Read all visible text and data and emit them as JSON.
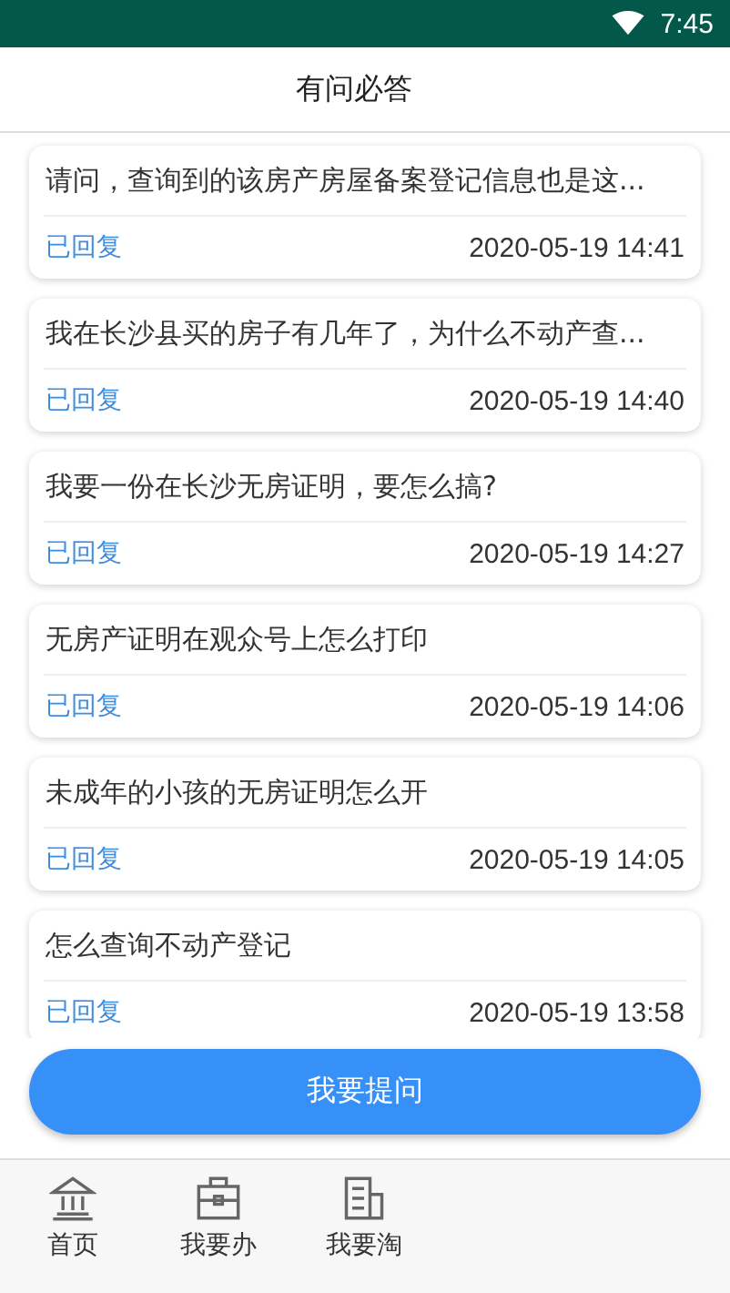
{
  "status_bar": {
    "time": "7:45"
  },
  "header": {
    "title": "有问必答"
  },
  "questions": [
    {
      "question": "请问，查询到的该房产房屋备案登记信息也是这...",
      "status": "已回复",
      "time": "2020-05-19 14:41"
    },
    {
      "question": "我在长沙县买的房子有几年了，为什么不动产查...",
      "status": "已回复",
      "time": "2020-05-19 14:40"
    },
    {
      "question": "我要一份在长沙无房证明，要怎么搞?",
      "status": "已回复",
      "time": "2020-05-19 14:27"
    },
    {
      "question": "无房产证明在观众号上怎么打印",
      "status": "已回复",
      "time": "2020-05-19 14:06"
    },
    {
      "question": "未成年的小孩的无房证明怎么开",
      "status": "已回复",
      "time": "2020-05-19 14:05"
    },
    {
      "question": "怎么查询不动产登记",
      "status": "已回复",
      "time": "2020-05-19 13:58"
    }
  ],
  "ask_button": "我要提问",
  "tabs": [
    {
      "label": "首页"
    },
    {
      "label": "我要办"
    },
    {
      "label": "我要淘"
    }
  ]
}
